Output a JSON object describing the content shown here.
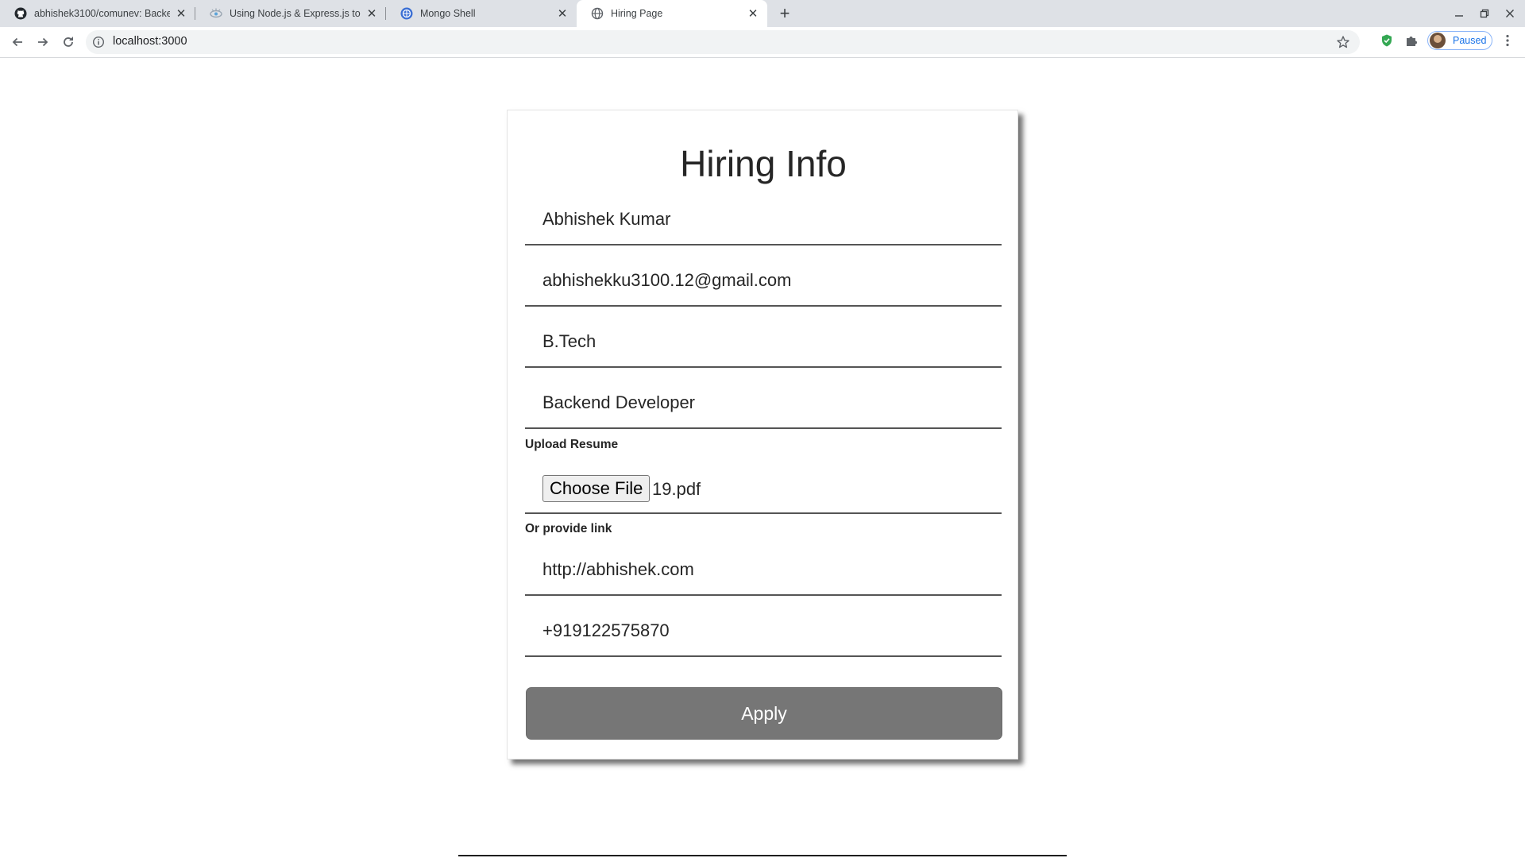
{
  "browser": {
    "tabs": [
      {
        "title": "abhishek3100/comunev: Backe",
        "favicon": "github-icon",
        "active": false
      },
      {
        "title": "Using Node.js & Express.js to s",
        "favicon": "eye-logo-icon",
        "active": false
      },
      {
        "title": "Mongo Shell",
        "favicon": "globe-logo-icon",
        "active": false
      },
      {
        "title": "Hiring Page",
        "favicon": "globe-icon",
        "active": true
      }
    ],
    "url": "localhost:3000",
    "profile_status": "Paused"
  },
  "form": {
    "title": "Hiring Info",
    "name": "Abhishek Kumar",
    "email": "abhishekku3100.12@gmail.com",
    "qualification": "B.Tech",
    "position": "Backend Developer",
    "upload_label": "Upload Resume",
    "choose_file_label": "Choose File",
    "file_name": "19.pdf",
    "link_label": "Or provide link",
    "resume_link": "http://abhishek.com",
    "phone": "+919122575870",
    "apply_label": "Apply"
  },
  "colors": {
    "apply_button": "#767676",
    "tabstrip": "#dee1e6",
    "profile_accent": "#1a73e8"
  }
}
